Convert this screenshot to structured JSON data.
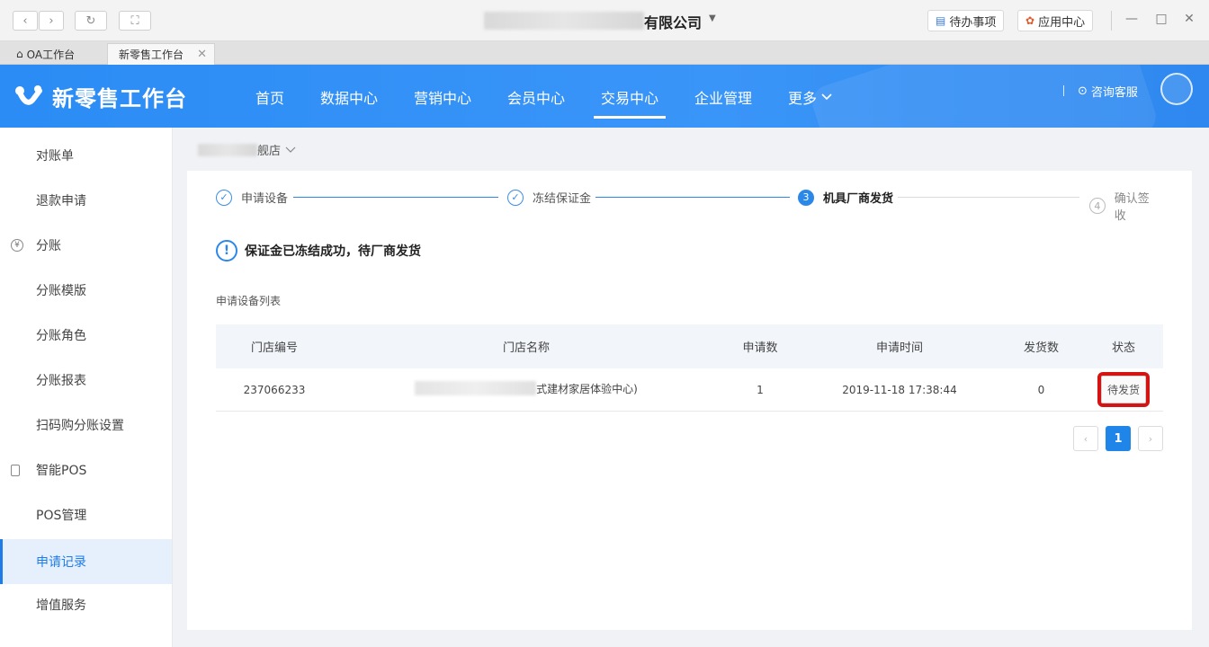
{
  "window": {
    "company_title": "有限公司",
    "todo_label": "待办事项",
    "app_center_label": "应用中心"
  },
  "tabs": [
    {
      "label": "OA工作台"
    },
    {
      "label": "新零售工作台"
    }
  ],
  "header": {
    "logo_text": "新零售工作台",
    "nav": [
      {
        "label": "首页"
      },
      {
        "label": "数据中心"
      },
      {
        "label": "营销中心"
      },
      {
        "label": "会员中心"
      },
      {
        "label": "交易中心"
      },
      {
        "label": "企业管理"
      },
      {
        "label": "更多"
      }
    ],
    "consult_label": "咨询客服"
  },
  "sidebar": {
    "items": [
      {
        "label": "对账单"
      },
      {
        "label": "退款申请"
      },
      {
        "label": "分账",
        "icon": "yen-icon"
      },
      {
        "label": "分账模版"
      },
      {
        "label": "分账角色"
      },
      {
        "label": "分账报表"
      },
      {
        "label": "扫码购分账设置"
      },
      {
        "label": "智能POS",
        "icon": "pos-icon"
      },
      {
        "label": "POS管理"
      },
      {
        "label": "申请记录"
      },
      {
        "label": "增值服务"
      }
    ]
  },
  "store": {
    "label": "舰店"
  },
  "steps": [
    {
      "num": "✓",
      "label": "申请设备",
      "state": "done"
    },
    {
      "num": "✓",
      "label": "冻结保证金",
      "state": "done"
    },
    {
      "num": "3",
      "label": "机具厂商发货",
      "state": "current"
    },
    {
      "num": "4",
      "label": "确认签收",
      "state": "todo"
    }
  ],
  "notice": {
    "icon": "!",
    "text": "保证金已冻结成功，待厂商发货"
  },
  "list_title": "申请设备列表",
  "table": {
    "headers": [
      "门店编号",
      "门店名称",
      "申请数",
      "申请时间",
      "发货数",
      "状态"
    ],
    "rows": [
      {
        "store_no": "237066233",
        "store_name": "式建材家居体验中心)",
        "count": "1",
        "time": "2019-11-18 17:38:44",
        "shipped": "0",
        "status": "待发货"
      }
    ]
  },
  "pagination": {
    "current": "1",
    "prev": "‹",
    "next": "›"
  }
}
